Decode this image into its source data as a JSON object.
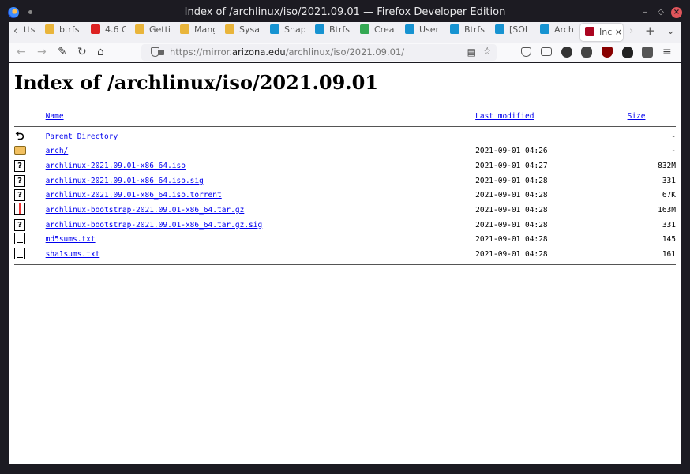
{
  "window": {
    "title": "Index of /archlinux/iso/2021.09.01 — Firefox Developer Edition"
  },
  "tabs": [
    {
      "label": "tts",
      "icon": "truncated-tab"
    },
    {
      "label": "btrfs",
      "icon": "tux-icon"
    },
    {
      "label": "4.6 C",
      "icon": "red-icon"
    },
    {
      "label": "Getti",
      "icon": "tux-icon"
    },
    {
      "label": "Mang",
      "icon": "tux-icon"
    },
    {
      "label": "Sysa",
      "icon": "tux-icon"
    },
    {
      "label": "Snap",
      "icon": "arch-icon"
    },
    {
      "label": "Btrfs",
      "icon": "arch-icon"
    },
    {
      "label": "Crea",
      "icon": "green-icon"
    },
    {
      "label": "User",
      "icon": "arch-icon"
    },
    {
      "label": "Btrfs",
      "icon": "arch-icon"
    },
    {
      "label": "[SOL",
      "icon": "arch-icon"
    },
    {
      "label": "Arch",
      "icon": "arch-icon"
    },
    {
      "label": "Inc",
      "icon": "arizona-icon"
    }
  ],
  "nav": {
    "url_prefix": "https://mirror.",
    "url_host": "arizona.edu",
    "url_path": "/archlinux/iso/2021.09.01/"
  },
  "page": {
    "heading": "Index of /archlinux/iso/2021.09.01",
    "columns": {
      "name": "Name",
      "modified": "Last modified",
      "size": "Size"
    },
    "rows": [
      {
        "name": "Parent Directory",
        "modified": "",
        "size": "-",
        "icon": "back-icon"
      },
      {
        "name": "arch/",
        "modified": "2021-09-01 04:26",
        "size": "-",
        "icon": "folder-icon"
      },
      {
        "name": "archlinux-2021.09.01-x86_64.iso",
        "modified": "2021-09-01 04:27",
        "size": "832M",
        "icon": "unknown-file-icon"
      },
      {
        "name": "archlinux-2021.09.01-x86_64.iso.sig",
        "modified": "2021-09-01 04:28",
        "size": "331",
        "icon": "unknown-file-icon"
      },
      {
        "name": "archlinux-2021.09.01-x86_64.iso.torrent",
        "modified": "2021-09-01 04:28",
        "size": "67K",
        "icon": "unknown-file-icon"
      },
      {
        "name": "archlinux-bootstrap-2021.09.01-x86_64.tar.gz",
        "modified": "2021-09-01 04:28",
        "size": "163M",
        "icon": "archive-icon"
      },
      {
        "name": "archlinux-bootstrap-2021.09.01-x86_64.tar.gz.sig",
        "modified": "2021-09-01 04:28",
        "size": "331",
        "icon": "unknown-file-icon"
      },
      {
        "name": "md5sums.txt",
        "modified": "2021-09-01 04:28",
        "size": "145",
        "icon": "text-file-icon"
      },
      {
        "name": "sha1sums.txt",
        "modified": "2021-09-01 04:28",
        "size": "161",
        "icon": "text-file-icon"
      }
    ]
  }
}
